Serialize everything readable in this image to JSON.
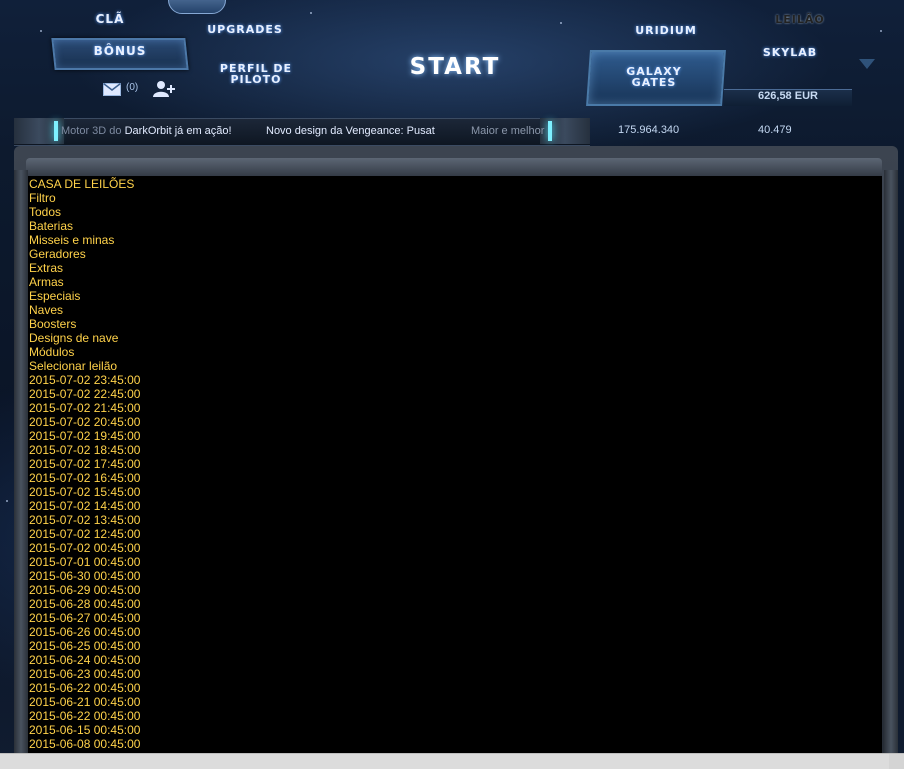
{
  "nav": {
    "cla": "CLÃ",
    "upgrades": "UPGRADES",
    "bonus": "BÔNUS",
    "perfil": "PERFIL DE PILOTO",
    "start": "START",
    "uridium": "URIDIUM",
    "leilao": "LEILÃO",
    "skylab": "SKYLAB",
    "galaxy_gates": "GALAXY GATES",
    "balance": "626,58 EUR",
    "mail_count": "(0)"
  },
  "ticker": {
    "item1_prefix": "Motor 3D do ",
    "item1_highlight": "DarkOrbit já em ação!",
    "item2": "Novo design da Vengeance: Pusat",
    "item3": "Maior e melhor"
  },
  "stats": {
    "credits": "175.964.340",
    "uridium": "40.479"
  },
  "content": {
    "items": [
      "CASA DE LEILÕES",
      "Filtro",
      "Todos",
      "Baterias",
      "Misseis e minas",
      "Geradores",
      "Extras",
      "Armas",
      "Especiais",
      "Naves",
      "Boosters",
      "Designs de nave",
      "Módulos",
      "Selecionar leilão",
      "2015-07-02 23:45:00",
      "2015-07-02 22:45:00",
      "2015-07-02 21:45:00",
      "2015-07-02 20:45:00",
      "2015-07-02 19:45:00",
      "2015-07-02 18:45:00",
      "2015-07-02 17:45:00",
      "2015-07-02 16:45:00",
      "2015-07-02 15:45:00",
      "2015-07-02 14:45:00",
      "2015-07-02 13:45:00",
      "2015-07-02 12:45:00",
      "2015-07-02 00:45:00",
      "2015-07-01 00:45:00",
      "2015-06-30 00:45:00",
      "2015-06-29 00:45:00",
      "2015-06-28 00:45:00",
      "2015-06-27 00:45:00",
      "2015-06-26 00:45:00",
      "2015-06-25 00:45:00",
      "2015-06-24 00:45:00",
      "2015-06-23 00:45:00",
      "2015-06-22 00:45:00",
      "2015-06-21 00:45:00",
      "2015-06-22 00:45:00",
      "2015-06-15 00:45:00",
      "2015-06-08 00:45:00"
    ]
  },
  "icons": {
    "mail": "mail-icon",
    "add_user": "add-friend-icon",
    "chevron": "chevron-down-icon"
  },
  "colors": {
    "link_text": "#ffd24a",
    "content_bg": "#000000",
    "nav_text": "#e8f0ff"
  }
}
